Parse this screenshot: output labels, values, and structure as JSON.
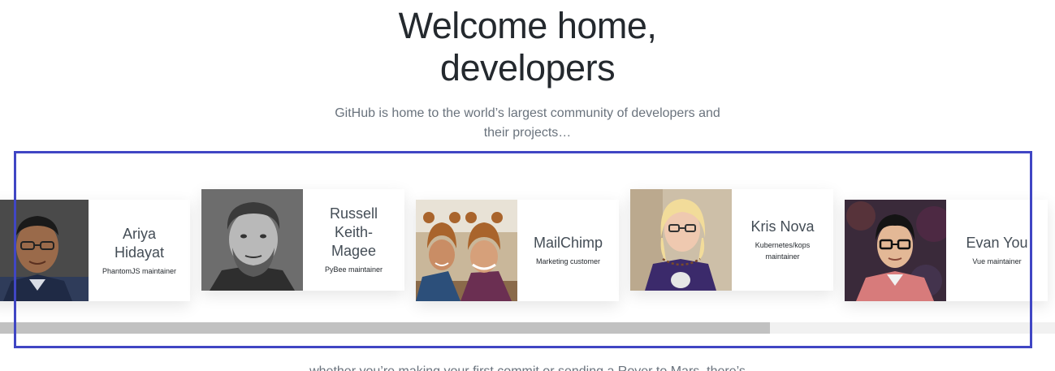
{
  "hero": {
    "title_line1": "Welcome home,",
    "title_line2": "developers",
    "subtitle_line1": "GitHub is home to the world’s largest community of developers and",
    "subtitle_line2": "their projects…"
  },
  "cards": [
    {
      "name_lines": [
        "Ariya",
        "Hidayat"
      ],
      "role_lines": [
        "PhantomJS maintainer"
      ]
    },
    {
      "name_lines": [
        "Russell",
        "Keith-",
        "Magee"
      ],
      "role_lines": [
        "PyBee maintainer"
      ]
    },
    {
      "name_lines": [
        "MailChimp"
      ],
      "role_lines": [
        "Marketing customer"
      ]
    },
    {
      "name_lines": [
        "Kris Nova"
      ],
      "role_lines": [
        "Kubernetes/kops",
        "maintainer"
      ]
    },
    {
      "name_lines": [
        "Evan You"
      ],
      "role_lines": [
        "Vue maintainer"
      ]
    }
  ],
  "scrollbar": {
    "thumb_fraction": 0.73
  },
  "below": {
    "text": "whether you’re making your first commit or sending a Rover to Mars, there’s"
  },
  "colors": {
    "highlight_border": "#4046c4",
    "heading": "#24292e",
    "muted": "#6a737d"
  }
}
